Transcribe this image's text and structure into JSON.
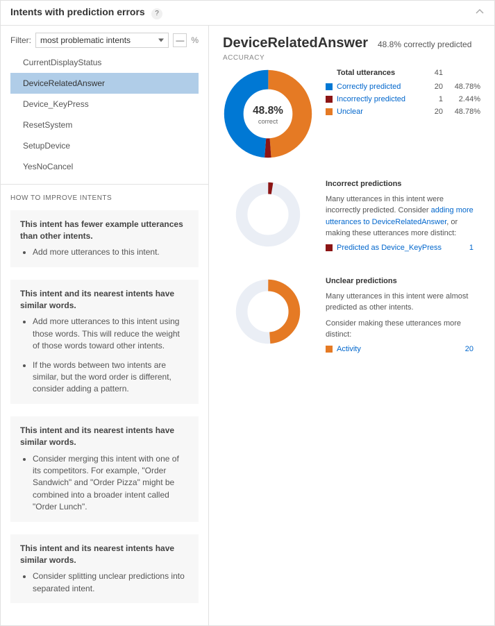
{
  "header": {
    "title": "Intents with prediction errors"
  },
  "filter": {
    "label": "Filter:",
    "selected": "most problematic intents",
    "pct_suffix": "%",
    "dash_label": "—"
  },
  "intents": [
    "CurrentDisplayStatus",
    "DeviceRelatedAnswer",
    "Device_KeyPress",
    "ResetSystem",
    "SetupDevice",
    "YesNoCancel"
  ],
  "selected_intent_index": 1,
  "howto": {
    "title": "HOW TO IMPROVE INTENTS",
    "cards": [
      {
        "head": "This intent has fewer example utterances than other intents.",
        "bullets": [
          "Add more utterances to this intent."
        ]
      },
      {
        "head": "This intent and its nearest intents have similar words.",
        "bullets": [
          "Add more utterances to this intent using those words. This will reduce the weight of those words toward other intents.",
          "If the words between two intents are similar, but the word order is different, consider adding a pattern."
        ]
      },
      {
        "head": "This intent and its nearest intents have similar words.",
        "bullets": [
          "Consider merging this intent with one of its competitors. For example, \"Order Sandwich\" and \"Order Pizza\" might be combined into a broader intent called \"Order Lunch\"."
        ]
      },
      {
        "head": "This intent and its nearest intents have similar words.",
        "bullets": [
          "Consider splitting unclear predictions into separated intent."
        ]
      }
    ]
  },
  "detail": {
    "title": "DeviceRelatedAnswer",
    "subtitle": "48.8% correctly predicted",
    "accuracy_label": "ACCURACY",
    "main_pct": "48.8%",
    "main_pct_sub": "correct",
    "total": {
      "label": "Total utterances",
      "count": "41"
    },
    "rows": [
      {
        "key": "correct",
        "color_class": "sw-blue",
        "label": "Correctly predicted",
        "count": "20",
        "pct": "48.78%"
      },
      {
        "key": "incorrect",
        "color_class": "sw-red",
        "label": "Incorrectly predicted",
        "count": "1",
        "pct": "2.44%"
      },
      {
        "key": "unclear",
        "color_class": "sw-orange",
        "label": "Unclear",
        "count": "20",
        "pct": "48.78%"
      }
    ],
    "incorrect": {
      "title": "Incorrect predictions",
      "text_before": "Many utterances in this intent were incorrectly predicted. Consider ",
      "link": "adding more utterances to DeviceRelatedAnswer",
      "text_after": ", or making these utterances more distinct:",
      "items": [
        {
          "swatch": "sw-red",
          "label": "Predicted as Device_KeyPress",
          "count": "1"
        }
      ]
    },
    "unclear": {
      "title": "Unclear predictions",
      "text_line1": "Many utterances in this intent were almost predicted as other intents.",
      "text_line2": "Consider making these utterances more distinct:",
      "items": [
        {
          "swatch": "sw-orange",
          "label": "Activity",
          "count": "20"
        }
      ]
    }
  },
  "chart_data": [
    {
      "type": "pie",
      "name": "accuracy_main",
      "series": [
        {
          "name": "Correctly predicted",
          "value": 20,
          "color": "#0078d4"
        },
        {
          "name": "Incorrectly predicted",
          "value": 1,
          "color": "#8c1515"
        },
        {
          "name": "Unclear",
          "value": 20,
          "color": "#e57a24"
        }
      ],
      "total": 41,
      "center_label": "48.8% correct"
    },
    {
      "type": "pie",
      "name": "incorrect_breakdown",
      "series": [
        {
          "name": "Predicted as Device_KeyPress",
          "value": 1,
          "color": "#8c1515"
        },
        {
          "name": "Other",
          "value": 40,
          "color": "#eaeef5"
        }
      ],
      "total": 41
    },
    {
      "type": "pie",
      "name": "unclear_breakdown",
      "series": [
        {
          "name": "Activity",
          "value": 20,
          "color": "#e57a24"
        },
        {
          "name": "Other",
          "value": 21,
          "color": "#eaeef5"
        }
      ],
      "total": 41
    }
  ]
}
